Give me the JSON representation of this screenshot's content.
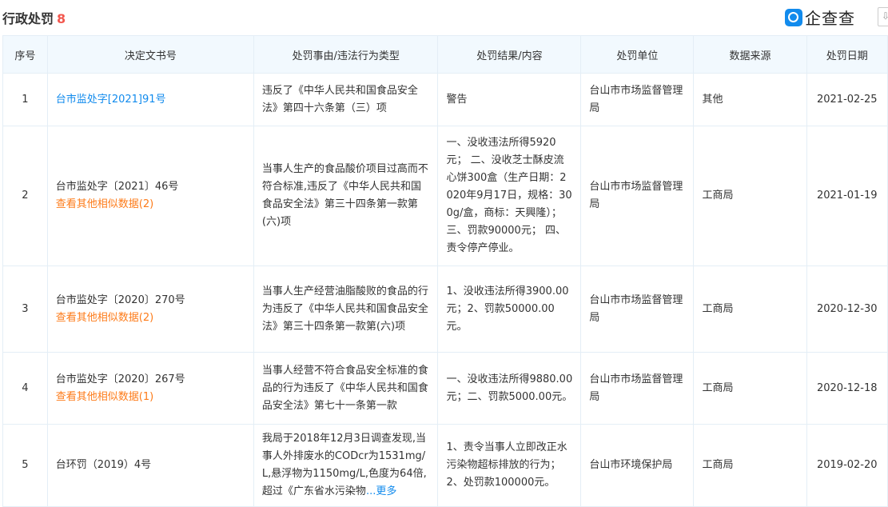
{
  "section": {
    "title": "行政处罚",
    "count": "8"
  },
  "brand": {
    "name": "企查查",
    "icon": "qichacha-logo-icon",
    "download_icon": "download-icon",
    "download_glyph": "⇩"
  },
  "columns": [
    "序号",
    "决定文书号",
    "处罚事由/违法行为类型",
    "处罚结果/内容",
    "处罚单位",
    "数据来源",
    "处罚日期"
  ],
  "rows": [
    {
      "index": "1",
      "doc_no": "台市监处字[2021]91号",
      "similar": "",
      "reason": "违反了《中华人民共和国食品安全法》第四十六条第（三）项",
      "result": "警告",
      "authority": "台山市市场监督管理局",
      "source": "其他",
      "date": "2021-02-25"
    },
    {
      "index": "2",
      "doc_no": "台市监处字〔2021〕46号",
      "similar": "查看其他相似数据(2)",
      "reason": "当事人生产的食品酸价项目过高而不符合标准,违反了《中华人民共和国食品安全法》第三十四条第一款第(六)项",
      "result": "一、没收违法所得5920元； 二、没收芝士酥皮流心饼300盒（生产日期：2020年9月17日，规格：300g/盒，商标：天興隆）；三、罚款90000元； 四、责令停产停业。",
      "authority": "台山市市场监督管理局",
      "source": "工商局",
      "date": "2021-01-19"
    },
    {
      "index": "3",
      "doc_no": "台市监处字〔2020〕270号",
      "similar": "查看其他相似数据(2)",
      "reason": "当事人生产经营油脂酸败的食品的行为违反了《中华人民共和国食品安全法》第三十四条第一款第(六)项",
      "result": "1、没收违法所得3900.00元；2、罚款50000.00元。",
      "authority": "台山市市场监督管理局",
      "source": "工商局",
      "date": "2020-12-30"
    },
    {
      "index": "4",
      "doc_no": "台市监处字〔2020〕267号",
      "similar": "查看其他相似数据(1)",
      "reason": "当事人经营不符合食品安全标准的食品的行为违反了《中华人民共和国食品安全法》第七十一条第一款",
      "result": "一、没收违法所得9880.00元；二、罚款5000.00元。",
      "authority": "台山市市场监督管理局",
      "source": "工商局",
      "date": "2020-12-18"
    },
    {
      "index": "5",
      "doc_no": "台环罚（2019）4号",
      "similar": "",
      "reason": "我局于2018年12月3日调查发现,当事人外排废水的CODcr为1531mg/L,悬浮物为1150mg/L,色度为64倍,超过《广东省水污染物",
      "reason_more": "...更多",
      "result": "1、责令当事人立即改正水污染物超标排放的行为；2、处罚款100000元。",
      "authority": "台山市环境保护局",
      "source": "工商局",
      "date": "2019-02-20"
    }
  ]
}
